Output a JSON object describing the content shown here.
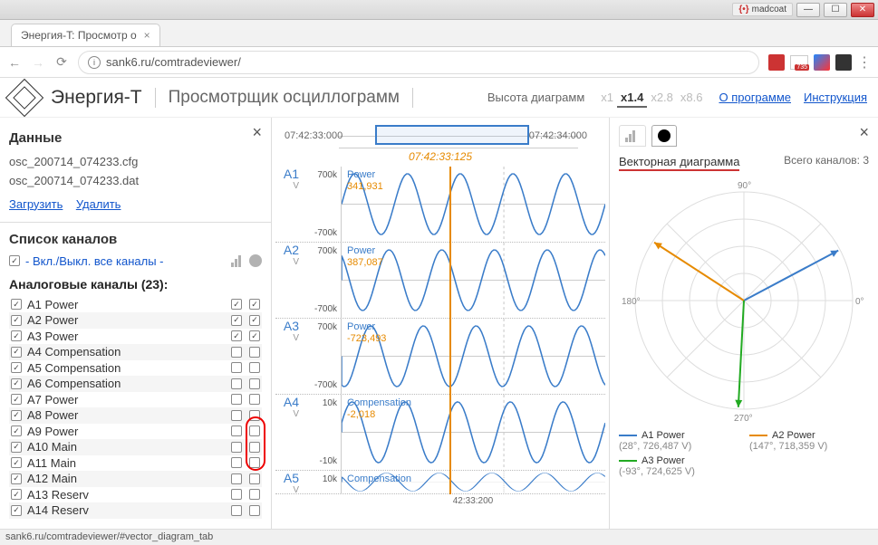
{
  "window": {
    "user": "madcoat"
  },
  "browser": {
    "tab_title": "Энергия-T: Просмотр о",
    "url": "sank6.ru/comtradeviewer/",
    "gmail_badge": "735"
  },
  "header": {
    "app_name": "Энергия-T",
    "subtitle": "Просмотрщик осциллограмм",
    "zoom_label": "Высота диаграмм",
    "zoom_opts": [
      "x1",
      "x1.4",
      "x2.8",
      "x8.6"
    ],
    "zoom_active": "x1.4",
    "about": "О программе",
    "manual": "Инструкция"
  },
  "left": {
    "data_title": "Данные",
    "files": [
      "osc_200714_074233.cfg",
      "osc_200714_074233.dat"
    ],
    "load": "Загрузить",
    "delete": "Удалить",
    "list_title": "Список каналов",
    "toggle_all": "- Вкл./Выкл. все каналы -",
    "analog_title": "Аналоговые каналы (23):",
    "channels": [
      {
        "name": "A1 Power",
        "c1": true,
        "c2": true,
        "c3": true
      },
      {
        "name": "A2 Power",
        "c1": true,
        "c2": true,
        "c3": true
      },
      {
        "name": "A3 Power",
        "c1": true,
        "c2": true,
        "c3": true
      },
      {
        "name": "A4 Compensation",
        "c1": true,
        "c2": false,
        "c3": false
      },
      {
        "name": "A5 Compensation",
        "c1": true,
        "c2": false,
        "c3": false
      },
      {
        "name": "A6 Compensation",
        "c1": true,
        "c2": false,
        "c3": false
      },
      {
        "name": "A7 Power",
        "c1": true,
        "c2": false,
        "c3": false
      },
      {
        "name": "A8 Power",
        "c1": true,
        "c2": false,
        "c3": false
      },
      {
        "name": "A9 Power",
        "c1": true,
        "c2": false,
        "c3": false
      },
      {
        "name": "A10 Main",
        "c1": true,
        "c2": false,
        "c3": false
      },
      {
        "name": "A11 Main",
        "c1": true,
        "c2": false,
        "c3": false
      },
      {
        "name": "A12 Main",
        "c1": true,
        "c2": false,
        "c3": false
      },
      {
        "name": "A13 Reserv",
        "c1": true,
        "c2": false,
        "c3": false
      },
      {
        "name": "A14 Reserv",
        "c1": true,
        "c2": false,
        "c3": false
      }
    ]
  },
  "center": {
    "t_start": "07:42:33:000",
    "t_end": "07:42:34:000",
    "cursor_time": "07:42:33:125",
    "x_tick": "42:33:200",
    "rows": [
      {
        "ch": "A1",
        "unit": "V",
        "ymax": "700k",
        "ymin": "-700k",
        "name": "Power",
        "val": "341,931"
      },
      {
        "ch": "A2",
        "unit": "V",
        "ymax": "700k",
        "ymin": "-700k",
        "name": "Power",
        "val": "387,087"
      },
      {
        "ch": "A3",
        "unit": "V",
        "ymax": "700k",
        "ymin": "-700k",
        "name": "Power",
        "val": "-723,493"
      },
      {
        "ch": "A4",
        "unit": "V",
        "ymax": "10k",
        "ymin": "-10k",
        "name": "Compensation",
        "val": "-2,018"
      },
      {
        "ch": "A5",
        "unit": "V",
        "ymax": "10k",
        "ymin": "",
        "name": "Compensation",
        "val": ""
      }
    ]
  },
  "right": {
    "title": "Векторная диаграмма",
    "count_label": "Всего каналов: 3",
    "angles": {
      "t0": "0°",
      "t90": "90°",
      "t180": "180°",
      "t270": "270°"
    },
    "legend": [
      {
        "color": "#3a7cc9",
        "name": "A1 Power",
        "val": "(28°, 726,487 V)"
      },
      {
        "color": "#e68a00",
        "name": "A2 Power",
        "val": "(147°, 718,359 V)"
      },
      {
        "color": "#2a2",
        "name": "A3 Power",
        "val": "(-93°, 724,625 V)"
      }
    ]
  },
  "status": "sank6.ru/comtradeviewer/#vector_diagram_tab",
  "chart_data": {
    "oscillogram": {
      "cursor": "07:42:33:125",
      "window": [
        "07:42:33:000",
        "07:42:34:000"
      ],
      "signals": [
        {
          "id": "A1",
          "name": "Power",
          "unit": "V",
          "y_range": [
            -700000,
            700000
          ],
          "cursor_value": 341931,
          "type": "sine"
        },
        {
          "id": "A2",
          "name": "Power",
          "unit": "V",
          "y_range": [
            -700000,
            700000
          ],
          "cursor_value": 387087,
          "type": "sine"
        },
        {
          "id": "A3",
          "name": "Power",
          "unit": "V",
          "y_range": [
            -700000,
            700000
          ],
          "cursor_value": -723493,
          "type": "sine"
        },
        {
          "id": "A4",
          "name": "Compensation",
          "unit": "V",
          "y_range": [
            -10000,
            10000
          ],
          "cursor_value": -2018,
          "type": "sine"
        },
        {
          "id": "A5",
          "name": "Compensation",
          "unit": "V",
          "y_range": [
            -10000,
            10000
          ],
          "cursor_value": null,
          "type": "sine"
        }
      ]
    },
    "vector_diagram": {
      "type": "polar",
      "vectors": [
        {
          "name": "A1 Power",
          "angle_deg": 28,
          "magnitude": 726487,
          "unit": "V",
          "color": "#3a7cc9"
        },
        {
          "name": "A2 Power",
          "angle_deg": 147,
          "magnitude": 718359,
          "unit": "V",
          "color": "#e68a00"
        },
        {
          "name": "A3 Power",
          "angle_deg": -93,
          "magnitude": 724625,
          "unit": "V",
          "color": "#2a2"
        }
      ]
    }
  }
}
